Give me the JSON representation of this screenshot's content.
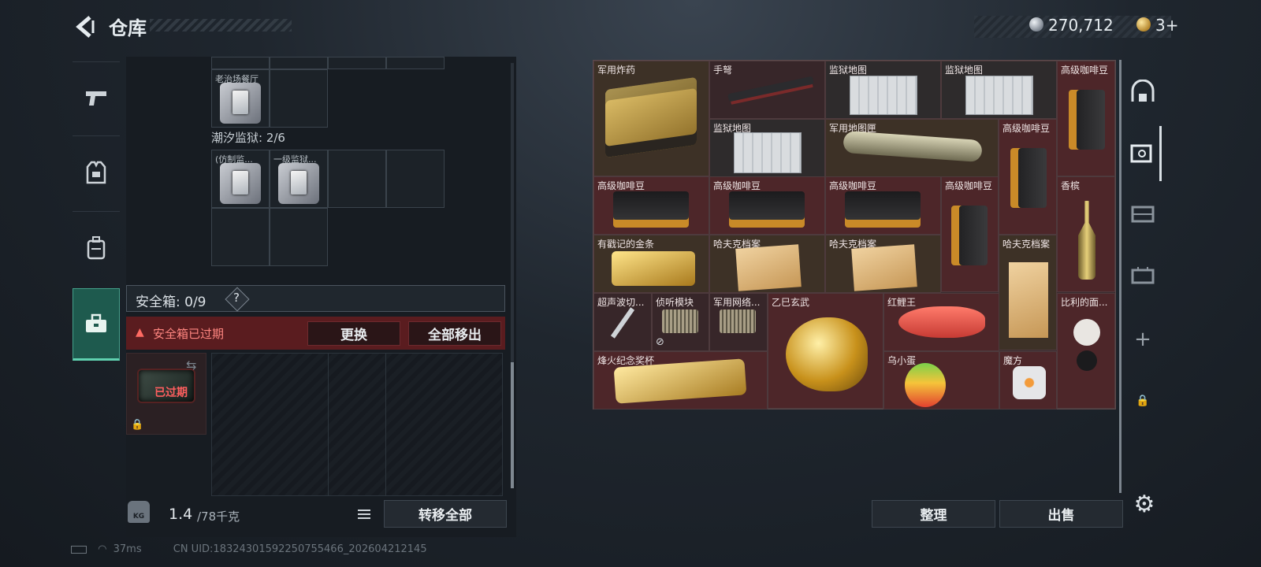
{
  "header": {
    "title": "仓库",
    "silver_amount": "270,712",
    "gold_amount": "3+"
  },
  "left_nav": {
    "items": [
      {
        "name": "weapon",
        "icon": "pistol-icon"
      },
      {
        "name": "armor",
        "icon": "vest-icon"
      },
      {
        "name": "backpack",
        "icon": "backpack-icon"
      },
      {
        "name": "safebox",
        "icon": "toolbox-icon",
        "active": true
      }
    ]
  },
  "keys": {
    "cell_a_label": "老治场餐厅",
    "prison_label": "潮汐监狱: 2/6",
    "cell_b_label": "(仿制监...",
    "cell_c_label": "一级监狱..."
  },
  "safebox": {
    "label": "安全箱: 0/9",
    "help": "?",
    "expired_warning": "安全箱已过期",
    "replace_label": "更换",
    "remove_all_label": "全部移出",
    "case_status": "已过期"
  },
  "footer_left": {
    "weight_badge": "KG",
    "weight_value": "1.4",
    "weight_unit": "/78千克",
    "transfer_label": "转移全部"
  },
  "stash": {
    "items": [
      {
        "label": "军用炸药"
      },
      {
        "label": "手弩"
      },
      {
        "label": "监狱地图"
      },
      {
        "label": "监狱地图"
      },
      {
        "label": "高级咖啡豆"
      },
      {
        "label": "监狱地图"
      },
      {
        "label": "军用地图匣"
      },
      {
        "label": "高级咖啡豆"
      },
      {
        "label": "高级咖啡豆"
      },
      {
        "label": "高级咖啡豆"
      },
      {
        "label": "高级咖啡豆"
      },
      {
        "label": "高级咖啡豆"
      },
      {
        "label": "香槟"
      },
      {
        "label": "有戳记的金条"
      },
      {
        "label": "哈夫克档案"
      },
      {
        "label": "哈夫克档案"
      },
      {
        "label": "哈夫克档案"
      },
      {
        "label": "超声波切..."
      },
      {
        "label": "侦听模块"
      },
      {
        "label": "军用网络..."
      },
      {
        "label": "乙巳玄武"
      },
      {
        "label": "红鲤王"
      },
      {
        "label": "比利的面..."
      },
      {
        "label": "烽火纪念奖杯"
      },
      {
        "label": "乌小蛋"
      },
      {
        "label": "魔方"
      }
    ],
    "sort_label": "整理",
    "sell_label": "出售"
  },
  "right_nav": {
    "items": [
      "bunker-icon",
      "safe-icon",
      "shelf-icon",
      "storage-icon",
      "plus-icon",
      "lock-icon"
    ]
  },
  "status_bar": {
    "ping": "37ms",
    "uid": "CN UID:18324301592250755466_202604212145"
  },
  "colors": {
    "accent_green": "#1e5a4e",
    "warning_red": "#5a1c1f",
    "stash_bg": "#3a2c2e"
  }
}
